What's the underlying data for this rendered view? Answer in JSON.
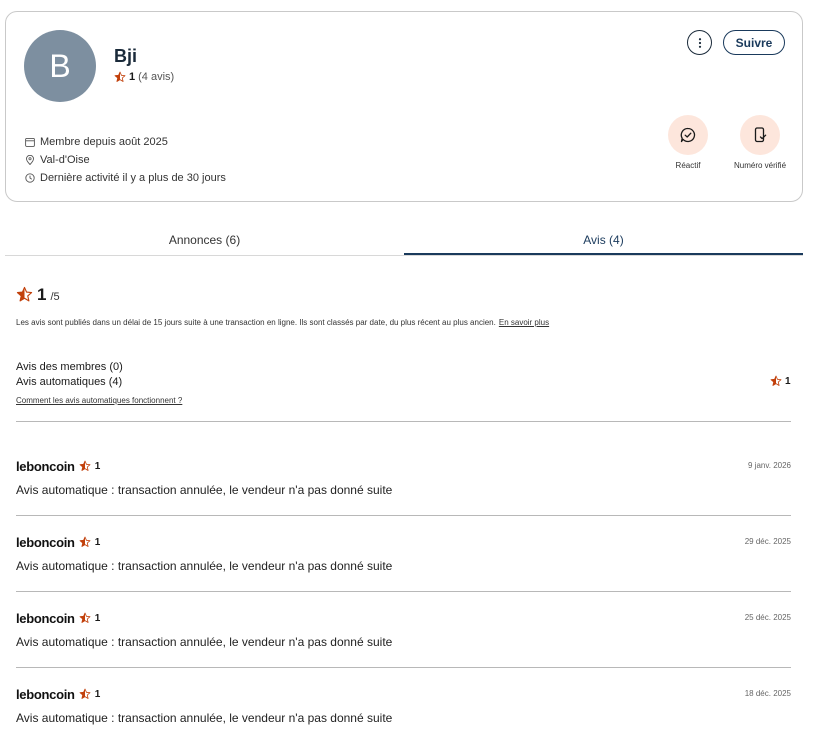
{
  "profile": {
    "avatar_letter": "B",
    "name": "Bji",
    "rating": "1",
    "reviews_count": "(4 avis)",
    "follow_label": "Suivre",
    "member_since": "Membre depuis août 2025",
    "location": "Val-d'Oise",
    "last_activity": "Dernière activité il y a plus de 30 jours",
    "badges": [
      {
        "label": "Réactif",
        "icon": "check-chat-icon"
      },
      {
        "label": "Numéro vérifié",
        "icon": "phone-check-icon"
      }
    ]
  },
  "tabs": [
    {
      "label": "Annonces (6)",
      "active": false
    },
    {
      "label": "Avis (4)",
      "active": true
    }
  ],
  "summary": {
    "rating": "1",
    "out_of": "/5",
    "notice": "Les avis sont publiés dans un délai de 15 jours suite à une transaction en ligne. Ils sont classés par date, du plus récent au plus ancien.",
    "learn_more": "En savoir plus",
    "member_reviews": "Avis des membres (0)",
    "auto_reviews": "Avis automatiques (4)",
    "auto_rating": "1",
    "how_link": "Comment les avis automatiques fonctionnent ?"
  },
  "reviews": [
    {
      "author": "leboncoin",
      "rating": "1",
      "date": "9 janv. 2026",
      "text": "Avis automatique : transaction annulée, le vendeur n'a pas donné suite"
    },
    {
      "author": "leboncoin",
      "rating": "1",
      "date": "29 déc. 2025",
      "text": "Avis automatique : transaction annulée, le vendeur n'a pas donné suite"
    },
    {
      "author": "leboncoin",
      "rating": "1",
      "date": "25 déc. 2025",
      "text": "Avis automatique : transaction annulée, le vendeur n'a pas donné suite"
    },
    {
      "author": "leboncoin",
      "rating": "1",
      "date": "18 déc. 2025",
      "text": "Avis automatique : transaction annulée, le vendeur n'a pas donné suite"
    }
  ],
  "colors": {
    "accent": "#1a3a5c",
    "star": "#c2410c",
    "badge_bg": "#fde6dc",
    "avatar_bg": "#7d8fa0"
  }
}
